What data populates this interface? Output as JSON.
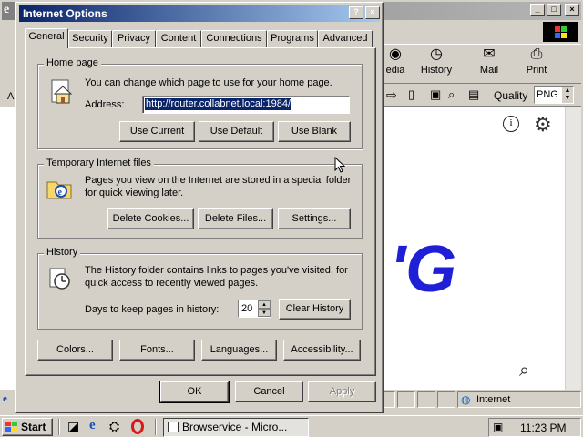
{
  "browser": {
    "title_icon": "ie-icon",
    "caption_buttons": [
      "_",
      "□",
      "×"
    ],
    "toolbar": [
      {
        "label": "edia",
        "icon": "media-icon"
      },
      {
        "label": "History",
        "icon": "history-icon"
      },
      {
        "label": "Mail",
        "icon": "mail-icon"
      },
      {
        "label": "Print",
        "icon": "print-icon"
      }
    ],
    "quality_label": "Quality",
    "quality_value": "PNG",
    "content_text": "'G",
    "status_zone": "Internet"
  },
  "dialog": {
    "title": "Internet Options",
    "help_button": "?",
    "close_button": "×",
    "tabs": [
      "General",
      "Security",
      "Privacy",
      "Content",
      "Connections",
      "Programs",
      "Advanced"
    ],
    "active_tab": "General",
    "home_page": {
      "label": "Home page",
      "description": "You can change which page to use for your home page.",
      "address_label": "Address:",
      "address_value": "http://router.collabnet.local:1984/",
      "buttons": {
        "use_current": "Use Current",
        "use_default": "Use Default",
        "use_blank": "Use Blank"
      }
    },
    "temp_files": {
      "label": "Temporary Internet files",
      "description_line1": "Pages you view on the Internet are stored in a special folder",
      "description_line2": "for quick viewing later.",
      "buttons": {
        "delete_cookies": "Delete Cookies...",
        "delete_files": "Delete Files...",
        "settings": "Settings..."
      }
    },
    "history": {
      "label": "History",
      "description_line1": "The History folder contains links to pages you've visited, for",
      "description_line2": "quick access to recently viewed pages.",
      "days_label": "Days to keep pages in history:",
      "days_value": "20",
      "clear_button": "Clear History"
    },
    "bottom_buttons": {
      "colors": "Colors...",
      "fonts": "Fonts...",
      "languages": "Languages...",
      "accessibility": "Accessibility..."
    },
    "footer_buttons": {
      "ok": "OK",
      "cancel": "Cancel",
      "apply": "Apply"
    }
  },
  "taskbar": {
    "start_label": "Start",
    "quicklaunch": [
      "show-desktop-icon",
      "ie-icon",
      "network-icon",
      "opera-icon"
    ],
    "task_label": "Browservice - Micro...",
    "clock": "11:23 PM"
  }
}
